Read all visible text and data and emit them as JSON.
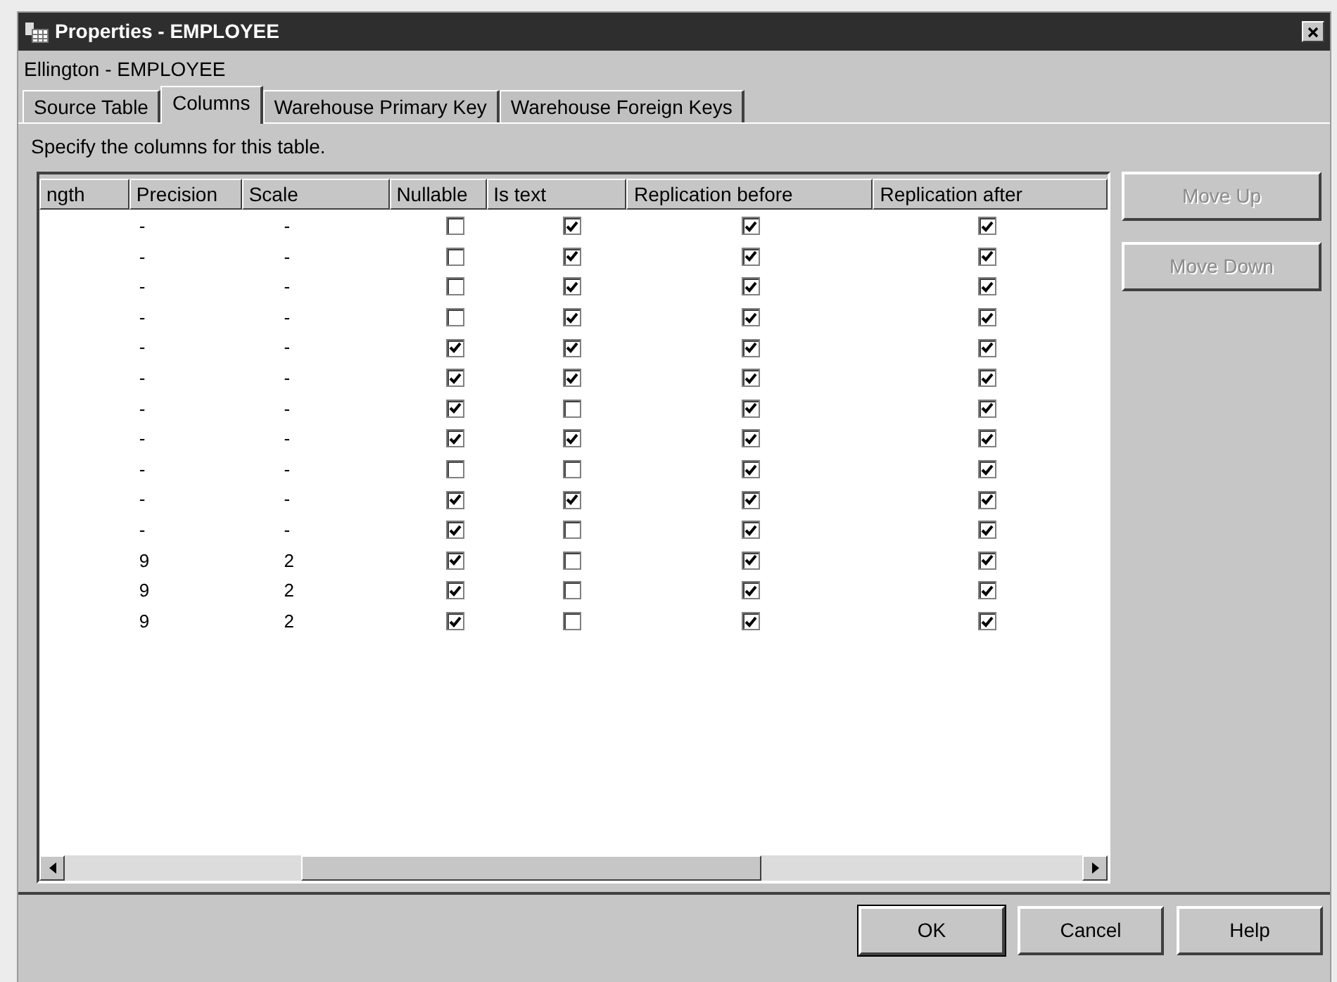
{
  "window": {
    "title": "Properties - EMPLOYEE",
    "subtitle": "Ellington - EMPLOYEE"
  },
  "tabs": [
    {
      "label": "Source Table",
      "selected": false
    },
    {
      "label": "Columns",
      "selected": true
    },
    {
      "label": "Warehouse Primary Key",
      "selected": false
    },
    {
      "label": "Warehouse Foreign Keys",
      "selected": false
    }
  ],
  "instruction": "Specify the columns for this table.",
  "table": {
    "columns": [
      "ngth",
      "Precision",
      "Scale",
      "Nullable",
      "Is text",
      "Replication before",
      "Replication after"
    ],
    "rows": [
      {
        "precision": "-",
        "scale": "-",
        "nullable": false,
        "is_text": true,
        "replication_before": true,
        "replication_after": true
      },
      {
        "precision": "-",
        "scale": "-",
        "nullable": false,
        "is_text": true,
        "replication_before": true,
        "replication_after": true
      },
      {
        "precision": "-",
        "scale": "-",
        "nullable": false,
        "is_text": true,
        "replication_before": true,
        "replication_after": true
      },
      {
        "precision": "-",
        "scale": "-",
        "nullable": false,
        "is_text": true,
        "replication_before": true,
        "replication_after": true
      },
      {
        "precision": "-",
        "scale": "-",
        "nullable": true,
        "is_text": true,
        "replication_before": true,
        "replication_after": true
      },
      {
        "precision": "-",
        "scale": "-",
        "nullable": true,
        "is_text": true,
        "replication_before": true,
        "replication_after": true
      },
      {
        "precision": "-",
        "scale": "-",
        "nullable": true,
        "is_text": false,
        "replication_before": true,
        "replication_after": true
      },
      {
        "precision": "-",
        "scale": "-",
        "nullable": true,
        "is_text": true,
        "replication_before": true,
        "replication_after": true
      },
      {
        "precision": "-",
        "scale": "-",
        "nullable": false,
        "is_text": false,
        "replication_before": true,
        "replication_after": true
      },
      {
        "precision": "-",
        "scale": "-",
        "nullable": true,
        "is_text": true,
        "replication_before": true,
        "replication_after": true
      },
      {
        "precision": "-",
        "scale": "-",
        "nullable": true,
        "is_text": false,
        "replication_before": true,
        "replication_after": true
      },
      {
        "precision": "9",
        "scale": "2",
        "nullable": true,
        "is_text": false,
        "replication_before": true,
        "replication_after": true
      },
      {
        "precision": "9",
        "scale": "2",
        "nullable": true,
        "is_text": false,
        "replication_before": true,
        "replication_after": true
      },
      {
        "precision": "9",
        "scale": "2",
        "nullable": true,
        "is_text": false,
        "replication_before": true,
        "replication_after": true
      }
    ]
  },
  "side_buttons": [
    {
      "label": "Move Up",
      "disabled": true
    },
    {
      "label": "Move Down",
      "disabled": true
    }
  ],
  "buttons": [
    {
      "label": "OK",
      "default": true
    },
    {
      "label": "Cancel",
      "default": false
    },
    {
      "label": "Help",
      "default": false
    }
  ]
}
